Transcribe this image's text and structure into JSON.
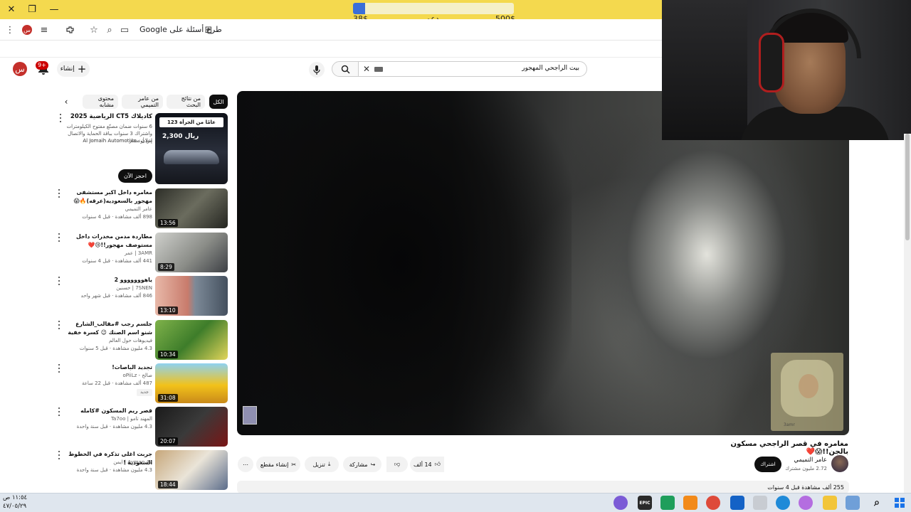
{
  "browser": {
    "goal": {
      "current": "38$",
      "label": "دعم",
      "target": "500$",
      "progress": 0.076
    },
    "address_text": "طرح أسئلة على Google",
    "profile_initial": "س"
  },
  "header": {
    "search_value": "بيت الراجحي المهجور",
    "create_label": "إنشاء",
    "notif_count": "9+",
    "avatar_initial": "س"
  },
  "chips": [
    "الكل",
    "من نتائج البحث",
    "من عامر التميمي",
    "محتوى مشابه"
  ],
  "ad": {
    "title": "كاديلاك CT5 الرياضية 2025",
    "desc": "6 سنوات ضمان مصنّع مفتوح الكيلومترات واشتراك 3 سنوات بباقة الحماية والاتصال من أونستار",
    "sponsor": "إعلان · Al Jomaih Automotive",
    "cta": "احجز الآن",
    "thumb_headline": "123 عامًا من الجرأة",
    "thumb_price": "2,300 ريال"
  },
  "related": [
    {
      "title": "مغامره داخل اكبر مستشفى مهجور بالسعوديه(عرقه)🔥😱",
      "channel": "عامر التميمي",
      "meta": "898 ألف مشاهدة · قبل 4 سنوات",
      "duration": "13:56"
    },
    {
      "title": "مطاردة مدمن مخدرات داخل مستوصف مهجور!!😢❤️",
      "channel": "3AMR | عمر",
      "meta": "441 ألف مشاهدة · قبل 4 سنوات",
      "duration": "8:29"
    },
    {
      "title": "ياهووووووو 2",
      "channel": "7SNEN | حسنين",
      "meta": "846 ألف مشاهدة · قبل شهر واحد",
      "duration": "13:10"
    },
    {
      "title": "جلسم رجب #مقالب_الشارع شنو اسم الصنك 😉 كسرة خفية 😂 أكبر فيديو اكل علي ...",
      "channel": "فيديوهات حول العالم",
      "meta": "4.3 مليون مشاهدة · قبل 5 سنوات",
      "duration": "10:34"
    },
    {
      "title": "تجديد الباصات!",
      "channel": "صالح - oPiiLz",
      "meta": "487 ألف مشاهدة · قبل 22 ساعة",
      "duration": "31:08",
      "badge": "جديد"
    },
    {
      "title": "قصر ريم المسكون #كامله",
      "channel": "المهند تامو | Ta7oo",
      "meta": "4.3 مليون مشاهدة · قبل سنة واحدة",
      "duration": "20:07"
    },
    {
      "title": "جربت اغلى تذكرة في الخطوط السعودية !",
      "channel": "Ayman Az | ايمن",
      "meta": "4.3 مليون مشاهدة · قبل سنة واحدة",
      "duration": "18:44"
    }
  ],
  "video": {
    "title": "مغامره في قصر الراجحي مسكون بالجن!!😱❤️",
    "channel": "عامر التميمي",
    "subs": "2.72 مليون مشترك",
    "subscribe_label": "اشتراك",
    "likes": "14 ألف",
    "share_label": "مشاركة",
    "download_label": "تنزيل",
    "clip_label": "إنشاء مقطع",
    "views_line": "255 ألف مشاهدة  قبل 4 سنوات",
    "snap_tag": "3amr"
  },
  "taskbar": {
    "time": "١١:٥٤ ص",
    "date": "٤٧/٠٥/٢٩",
    "epic_label": "EPIC"
  },
  "colors": {
    "accent_yellow": "#f4d94e",
    "yt_red": "#cc0000"
  }
}
